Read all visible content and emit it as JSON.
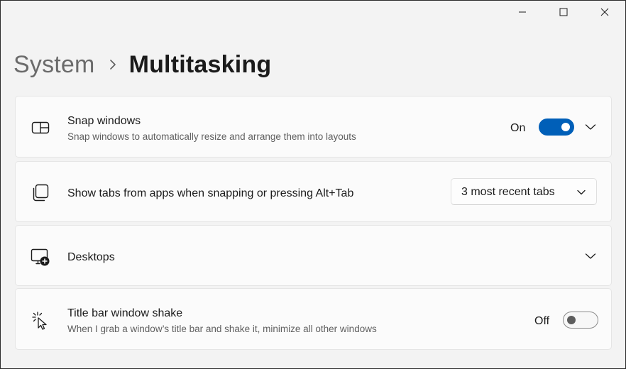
{
  "window": {
    "caption": {
      "minimize_icon": "minimize-icon",
      "maximize_icon": "maximize-icon",
      "close_icon": "close-icon"
    }
  },
  "breadcrumb": {
    "parent": "System",
    "separator_icon": "chevron-right-icon",
    "current": "Multitasking"
  },
  "settings": {
    "snap_windows": {
      "icon": "snap-layout-icon",
      "title": "Snap windows",
      "description": "Snap windows to automatically resize and arrange them into layouts",
      "state_label": "On",
      "enabled": true,
      "expand_icon": "chevron-down-icon"
    },
    "show_tabs": {
      "icon": "stacked-windows-icon",
      "title": "Show tabs from apps when snapping or pressing Alt+Tab",
      "selected_option": "3 most recent tabs"
    },
    "desktops": {
      "icon": "add-desktop-icon",
      "title": "Desktops",
      "expand_icon": "chevron-down-icon"
    },
    "title_bar_shake": {
      "icon": "shake-cursor-icon",
      "title": "Title bar window shake",
      "description": "When I grab a window’s title bar and shake it, minimize all other windows",
      "state_label": "Off",
      "enabled": false
    }
  },
  "colors": {
    "accent": "#005fb8",
    "background": "#f3f3f3",
    "card": "#fbfbfb",
    "secondary_text": "#5f5f5f"
  }
}
